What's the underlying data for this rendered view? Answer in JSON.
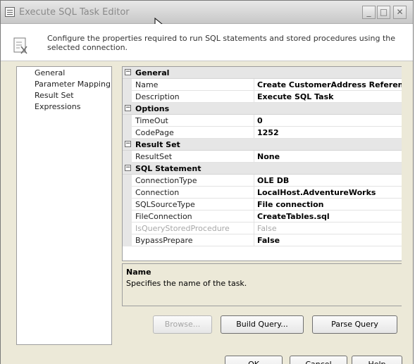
{
  "window": {
    "title": "Execute SQL Task Editor"
  },
  "header": {
    "description": "Configure the properties required to run SQL statements and stored procedures using the selected connection."
  },
  "nav": {
    "items": [
      {
        "label": "General"
      },
      {
        "label": "Parameter Mapping"
      },
      {
        "label": "Result Set"
      },
      {
        "label": "Expressions"
      }
    ]
  },
  "grid": {
    "general": {
      "label": "General",
      "name": {
        "name": "Name",
        "value": "Create CustomerAddress Reference"
      },
      "description": {
        "name": "Description",
        "value": "Execute SQL Task"
      }
    },
    "options": {
      "label": "Options",
      "timeout": {
        "name": "TimeOut",
        "value": "0"
      },
      "codepage": {
        "name": "CodePage",
        "value": "1252"
      }
    },
    "result_set": {
      "label": "Result Set",
      "resultset": {
        "name": "ResultSet",
        "value": "None"
      }
    },
    "sql_statement": {
      "label": "SQL Statement",
      "connectiontype": {
        "name": "ConnectionType",
        "value": "OLE DB"
      },
      "connection": {
        "name": "Connection",
        "value": "LocalHost.AdventureWorks"
      },
      "sqlsourcetype": {
        "name": "SQLSourceType",
        "value": "File connection"
      },
      "fileconnection": {
        "name": "FileConnection",
        "value": "CreateTables.sql"
      },
      "isquerystoredprocedure": {
        "name": "IsQueryStoredProcedure",
        "value": "False"
      },
      "bypassprepare": {
        "name": "BypassPrepare",
        "value": "False"
      }
    }
  },
  "desc": {
    "title": "Name",
    "text": "Specifies the name of the task."
  },
  "buttons": {
    "browse": "Browse...",
    "build_query": "Build Query...",
    "parse_query": "Parse Query",
    "ok": "OK",
    "cancel": "Cancel",
    "help": "Help"
  }
}
